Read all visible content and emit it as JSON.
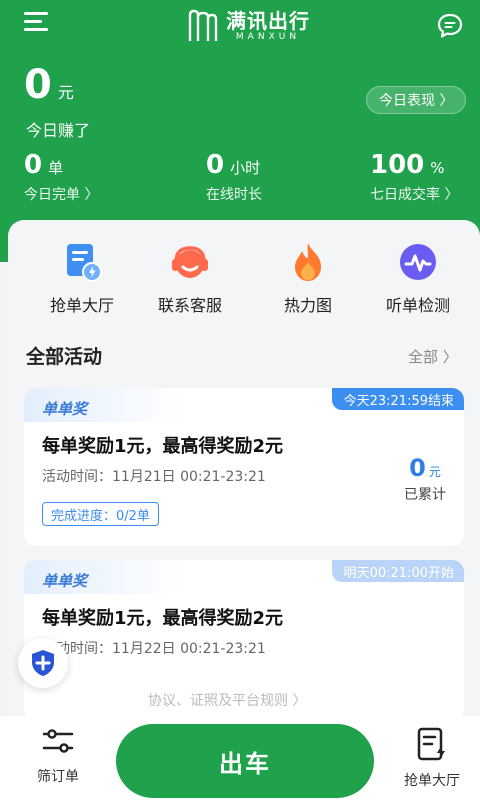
{
  "header": {
    "logo_cn": "满讯出行",
    "logo_en": "MANXUN",
    "earn_amount": "0",
    "earn_unit": "元",
    "earn_label": "今日赚了",
    "today_button": "今日表现 〉"
  },
  "stats": [
    {
      "value": "0",
      "unit": "单",
      "label": "今日完单 〉"
    },
    {
      "value": "0",
      "unit": "小时",
      "label": "在线时长"
    },
    {
      "value": "100",
      "unit": "%",
      "label": "七日成交率 〉"
    }
  ],
  "quick_actions": [
    {
      "label": "抢单大厅",
      "icon": "order-hall-icon"
    },
    {
      "label": "联系客服",
      "icon": "headset-icon"
    },
    {
      "label": "热力图",
      "icon": "flame-icon"
    },
    {
      "label": "听单检测",
      "icon": "pulse-icon"
    }
  ],
  "activities": {
    "title": "全部活动",
    "more": "全部 〉",
    "cards": [
      {
        "tag": "单单奖",
        "deadline": "今天23:21:59结束",
        "title": "每单奖励1元，最高得奖励2元",
        "time": "活动时间：11月21日 00:21-23:21",
        "progress": "完成进度：0/2单",
        "accumulated_num": "0",
        "accumulated_unit": "元",
        "accumulated_label": "已累计"
      },
      {
        "tag": "单单奖",
        "deadline": "明天00:21:00开始",
        "title": "每单奖励1元，最高得奖励2元",
        "time": "活动时间：11月22日 00:21-23:21"
      }
    ],
    "footer_link": "协议、证照及平台规则 〉"
  },
  "bottom_bar": {
    "left_label": "筛订单",
    "go_button": "出车",
    "right_label": "抢单大厅"
  },
  "colors": {
    "brand_green": "#1fa24b",
    "accent_blue": "#3c8ef0"
  }
}
